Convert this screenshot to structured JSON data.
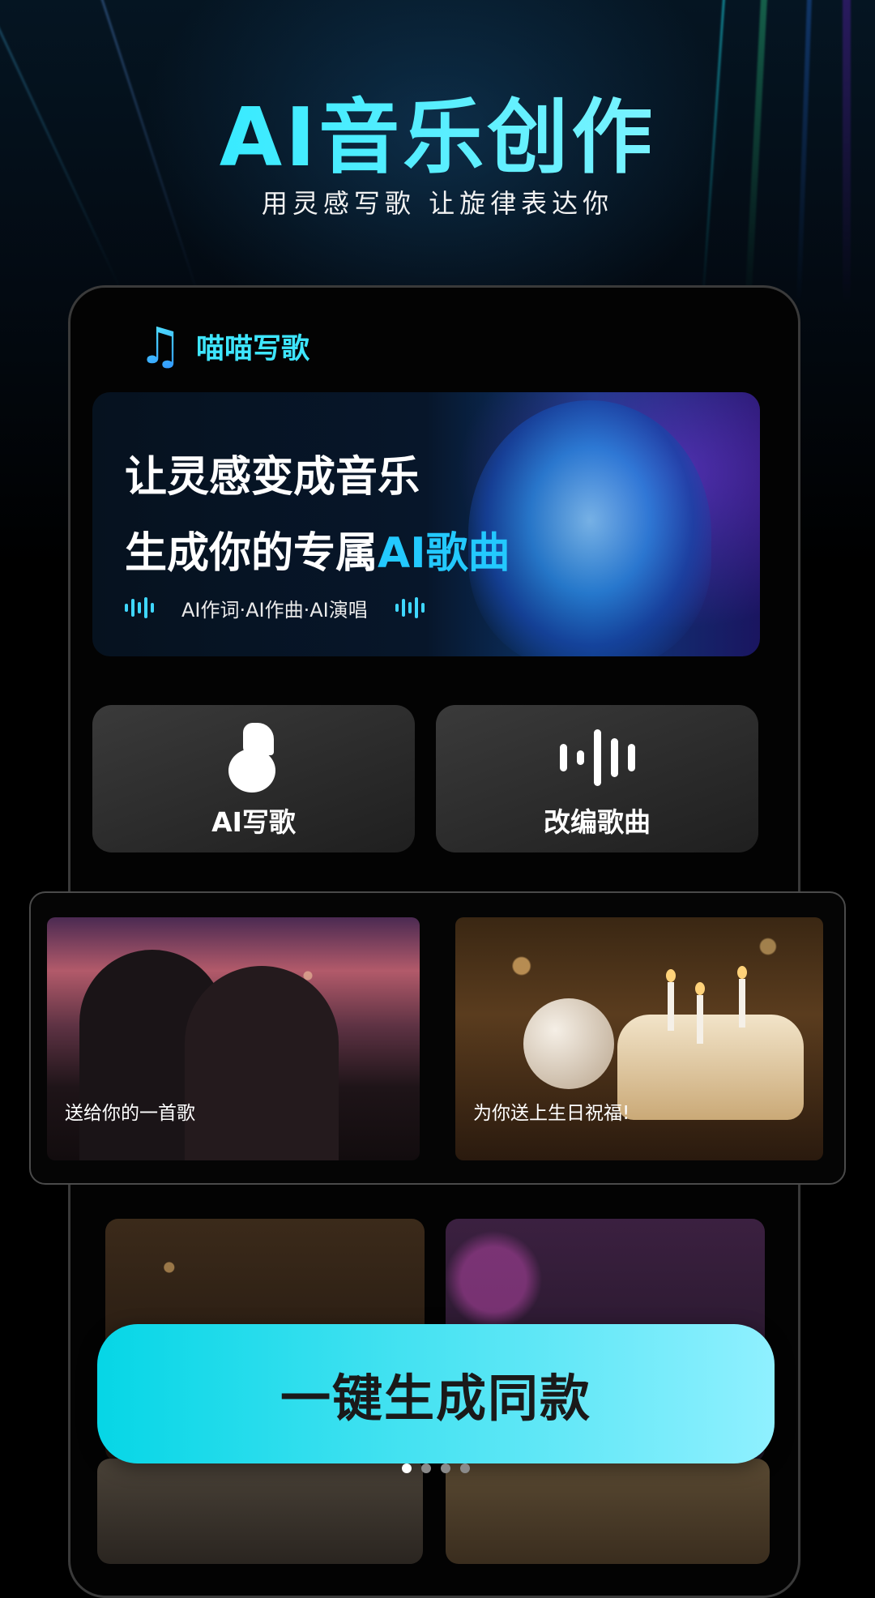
{
  "hero": {
    "title": "AI音乐创作",
    "subtitle": "用灵感写歌 让旋律表达你"
  },
  "app": {
    "name": "喵喵写歌",
    "logo_icon": "music-note-icon"
  },
  "banner": {
    "line1": "让灵感变成音乐",
    "line2_prefix": "生成你的专属",
    "line2_highlight": "AI歌曲",
    "features": "AI作词·AI作曲·AI演唱",
    "highlight_color": "#23c9ff"
  },
  "actions": [
    {
      "label": "AI写歌",
      "icon": "music-note-icon"
    },
    {
      "label": "改编歌曲",
      "icon": "sound-wave-icon"
    }
  ],
  "templates": [
    {
      "caption": "送给你的一首歌"
    },
    {
      "caption": "为你送上生日祝福!"
    }
  ],
  "cta": {
    "label": "一键生成同款"
  },
  "pagination": {
    "count": 4,
    "active": 0
  },
  "colors": {
    "accent": "#17e6ff",
    "cta_start": "#06d6e6",
    "cta_end": "#8ff0ff"
  }
}
